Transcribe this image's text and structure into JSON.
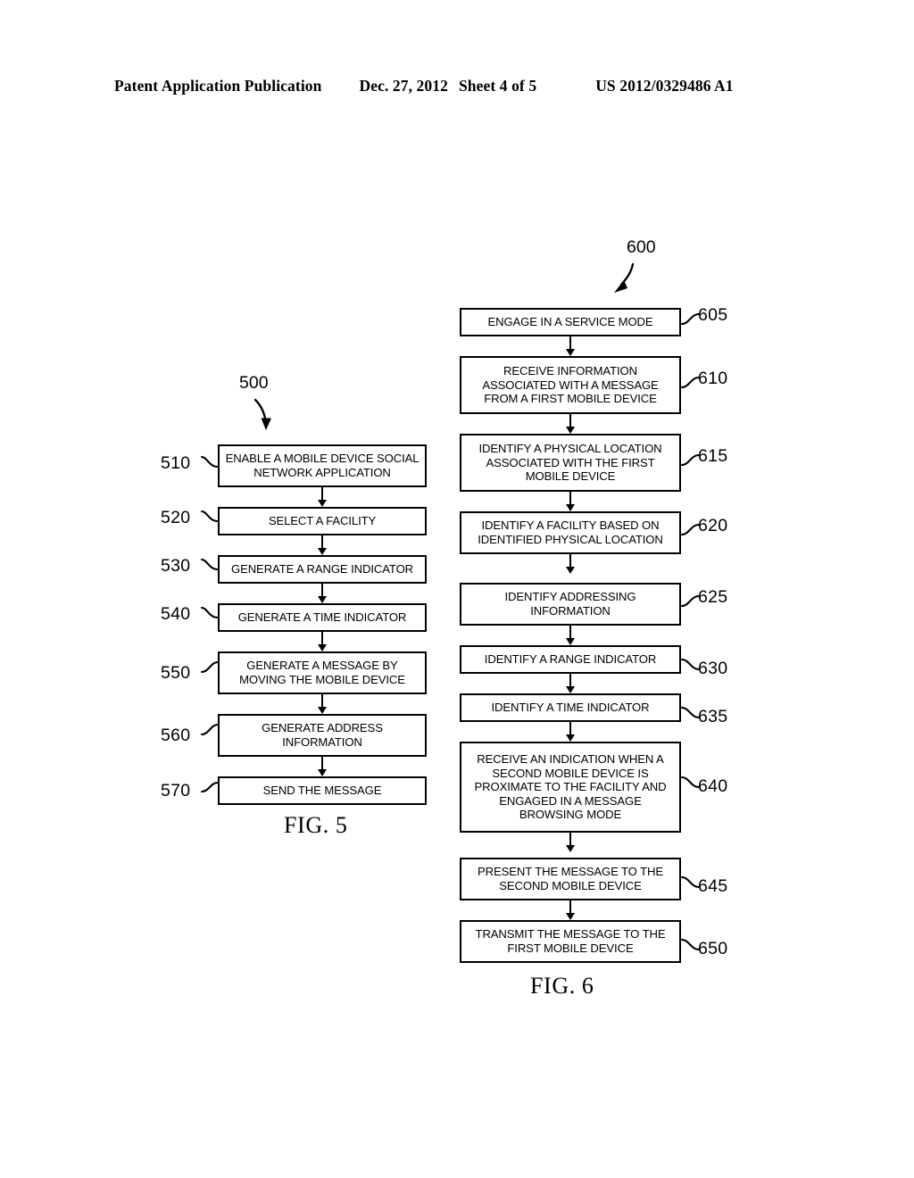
{
  "header": {
    "publication": "Patent Application Publication",
    "date": "Dec. 27, 2012",
    "sheet": "Sheet 4 of 5",
    "document_number": "US 2012/0329486 A1"
  },
  "figures": [
    {
      "id": "fig5",
      "figure_id_label": "500",
      "caption": "FIG. 5",
      "steps": [
        {
          "ref": "510",
          "text": "ENABLE A MOBILE DEVICE SOCIAL NETWORK APPLICATION",
          "lines": 2
        },
        {
          "ref": "520",
          "text": "SELECT A FACILITY",
          "lines": 1
        },
        {
          "ref": "530",
          "text": "GENERATE A RANGE INDICATOR",
          "lines": 1
        },
        {
          "ref": "540",
          "text": "GENERATE A TIME INDICATOR",
          "lines": 1
        },
        {
          "ref": "550",
          "text": "GENERATE A MESSAGE BY MOVING THE MOBILE DEVICE",
          "lines": 2
        },
        {
          "ref": "560",
          "text": "GENERATE ADDRESS INFORMATION",
          "lines": 2
        },
        {
          "ref": "570",
          "text": "SEND THE MESSAGE",
          "lines": 1
        }
      ]
    },
    {
      "id": "fig6",
      "figure_id_label": "600",
      "caption": "FIG. 6",
      "steps": [
        {
          "ref": "605",
          "text": "ENGAGE IN A SERVICE MODE",
          "lines": 1
        },
        {
          "ref": "610",
          "text": "RECEIVE INFORMATION ASSOCIATED WITH A MESSAGE FROM A FIRST MOBILE DEVICE",
          "lines": 3
        },
        {
          "ref": "615",
          "text": "IDENTIFY A PHYSICAL LOCATION ASSOCIATED WITH THE FIRST MOBILE DEVICE",
          "lines": 3
        },
        {
          "ref": "620",
          "text": "IDENTIFY A FACILITY BASED ON IDENTIFIED PHYSICAL LOCATION",
          "lines": 2
        },
        {
          "ref": "625",
          "text": "IDENTIFY ADDRESSING INFORMATION",
          "lines": 2
        },
        {
          "ref": "630",
          "text": "IDENTIFY A RANGE INDICATOR",
          "lines": 1
        },
        {
          "ref": "635",
          "text": "IDENTIFY A TIME INDICATOR",
          "lines": 1
        },
        {
          "ref": "640",
          "text": "RECEIVE AN INDICATION WHEN A SECOND MOBILE DEVICE IS PROXIMATE TO THE FACILITY AND ENGAGED IN A MESSAGE BROWSING MODE",
          "lines": 5
        },
        {
          "ref": "645",
          "text": "PRESENT THE MESSAGE TO THE SECOND MOBILE DEVICE",
          "lines": 2
        },
        {
          "ref": "650",
          "text": "TRANSMIT THE MESSAGE TO THE FIRST MOBILE DEVICE",
          "lines": 2
        }
      ]
    }
  ]
}
